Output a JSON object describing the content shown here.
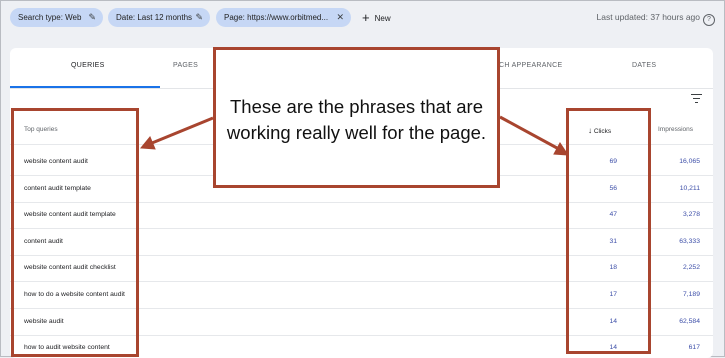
{
  "filters": {
    "chip1": "Search type: Web",
    "chip2": "Date: Last 12 months",
    "chip3": "Page: https://www.orbitmed...",
    "new_label": "New",
    "last_updated": "Last updated: 37 hours ago"
  },
  "tabs": [
    "QUERIES",
    "PAGES",
    "CH APPEARANCE",
    "DATES"
  ],
  "table": {
    "col_query": "Top queries",
    "col_clicks": "Clicks",
    "col_impressions": "Impressions",
    "rows": [
      {
        "query": "website content audit",
        "clicks": "69",
        "impressions": "16,065"
      },
      {
        "query": "content audit template",
        "clicks": "56",
        "impressions": "10,211"
      },
      {
        "query": "website content audit template",
        "clicks": "47",
        "impressions": "3,278"
      },
      {
        "query": "content audit",
        "clicks": "31",
        "impressions": "63,333"
      },
      {
        "query": "website content audit checklist",
        "clicks": "18",
        "impressions": "2,252"
      },
      {
        "query": "how to do a website content audit",
        "clicks": "17",
        "impressions": "7,189"
      },
      {
        "query": "website audit",
        "clicks": "14",
        "impressions": "62,584"
      },
      {
        "query": "how to audit website content",
        "clicks": "14",
        "impressions": "617"
      }
    ]
  },
  "callout": {
    "line1": "These are the phrases that are",
    "line2": "working really well for the page."
  },
  "colors": {
    "annotation": "#a8452f",
    "chip_bg": "#c6d7f5",
    "link": "#3c4ea8",
    "tab_accent": "#1a73e8"
  }
}
